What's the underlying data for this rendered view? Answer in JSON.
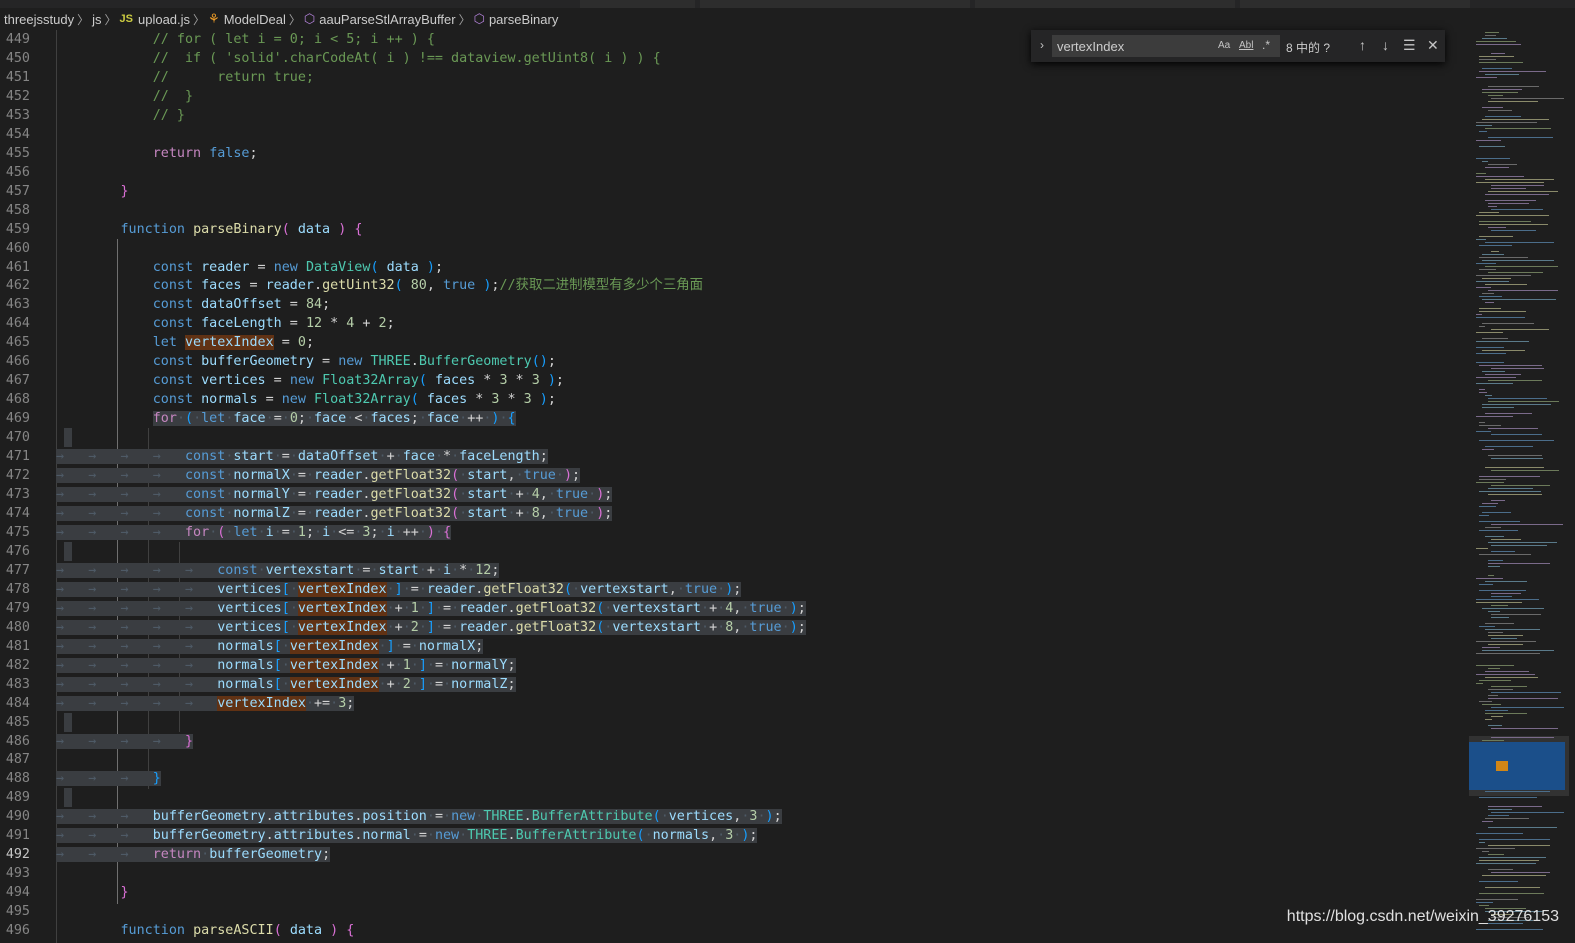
{
  "breadcrumb": {
    "items": [
      "threejsstudy",
      "js",
      "upload.js",
      "ModelDeal",
      "aauParseStlArrayBuffer",
      "parseBinary"
    ],
    "file_badge": "JS"
  },
  "find_widget": {
    "query": "vertexIndex",
    "match_case": "Aa",
    "whole_word": "Abl",
    "regex": ".*",
    "count": "8 中的 ?"
  },
  "editor": {
    "active_line": 492,
    "lines": [
      {
        "n": "449",
        "html": "<span class='cm'>// for ( let i = 0; i &lt; 5; i ++ ) {</span>",
        "pad": 6
      },
      {
        "n": "450",
        "html": "<span class='cm'>//  if ( 'solid'.charCodeAt( i ) !== dataview.getUint8( i ) ) {</span>",
        "pad": 6
      },
      {
        "n": "451",
        "html": "<span class='cm'>//      return true;</span>",
        "pad": 6
      },
      {
        "n": "452",
        "html": "<span class='cm'>//  }</span>",
        "pad": 6
      },
      {
        "n": "453",
        "html": "<span class='cm'>// }</span>",
        "pad": 6
      },
      {
        "n": "454",
        "html": "",
        "pad": 0
      },
      {
        "n": "455",
        "html": "<span class='ctl'>return</span> <span class='kw'>false</span>;",
        "pad": 6
      },
      {
        "n": "456",
        "html": "",
        "pad": 0
      },
      {
        "n": "457",
        "html": "<span class='b2'>}</span>",
        "pad": 4
      },
      {
        "n": "458",
        "html": "",
        "pad": 0
      },
      {
        "n": "459",
        "html": "<span class='kw'>function</span> <span class='fn'>parseBinary</span><span class='b2'>(</span> <span class='var'>data</span> <span class='b2'>)</span> <span class='b2'>{</span>",
        "pad": 4
      },
      {
        "n": "460",
        "html": "",
        "pad": 0
      },
      {
        "n": "461",
        "html": "<span class='kw'>const</span> <span class='var'>reader</span> = <span class='kw'>new</span> <span class='cls'>DataView</span><span class='b3'>(</span> <span class='var'>data</span> <span class='b3'>)</span>;",
        "pad": 6
      },
      {
        "n": "462",
        "html": "<span class='kw'>const</span> <span class='var'>faces</span> = <span class='var'>reader</span>.<span class='fn'>getUint32</span><span class='b3'>(</span> <span class='num'>80</span>, <span class='kw'>true</span> <span class='b3'>)</span>;<span class='cm'>//获取二进制模型有多少个三角面</span>",
        "pad": 6
      },
      {
        "n": "463",
        "html": "<span class='kw'>const</span> <span class='var'>dataOffset</span> = <span class='num'>84</span>;",
        "pad": 6
      },
      {
        "n": "464",
        "html": "<span class='kw'>const</span> <span class='var'>faceLength</span> = <span class='num'>12</span> * <span class='num'>4</span> + <span class='num'>2</span>;",
        "pad": 6
      },
      {
        "n": "465",
        "html": "<span class='kw'>let</span> <span class='var fm'>vertexIndex</span> = <span class='num'>0</span>;",
        "pad": 6
      },
      {
        "n": "466",
        "html": "<span class='kw'>const</span> <span class='var'>bufferGeometry</span> = <span class='kw'>new</span> <span class='cls'>THREE</span>.<span class='cls'>BufferGeometry</span><span class='b3'>()</span>;",
        "pad": 6
      },
      {
        "n": "467",
        "html": "<span class='kw'>const</span> <span class='var'>vertices</span> = <span class='kw'>new</span> <span class='cls'>Float32Array</span><span class='b3'>(</span> <span class='var'>faces</span> * <span class='num'>3</span> * <span class='num'>3</span> <span class='b3'>)</span>;",
        "pad": 6
      },
      {
        "n": "468",
        "html": "<span class='kw'>const</span> <span class='var'>normals</span> = <span class='kw'>new</span> <span class='cls'>Float32Array</span><span class='b3'>(</span> <span class='var'>faces</span> * <span class='num'>3</span> * <span class='num'>3</span> <span class='b3'>)</span>;",
        "pad": 6
      },
      {
        "n": "469",
        "html": "<span class='sel'><span class='ctl'>for</span><span class='ws'>·</span><span class='b3'>(</span><span class='ws'>·</span><span class='kw'>let</span><span class='ws'>·</span><span class='var'>face</span><span class='ws'>·</span>=<span class='ws'>·</span><span class='num'>0</span>;<span class='ws'>·</span><span class='var'>face</span><span class='ws'>·</span>&lt;<span class='ws'>·</span><span class='var'>faces</span>;<span class='ws'>·</span><span class='var'>face</span><span class='ws'>·</span>++<span class='ws'>·</span><span class='b3'>)</span><span class='ws'>·</span><span class='b3'>{</span></span>",
        "pad": 6,
        "selfrom": 6
      },
      {
        "n": "470",
        "html": "",
        "pad": 0,
        "selblank": true
      },
      {
        "n": "471",
        "html": "<span class='kw'>const</span><span class='ws'>·</span><span class='var'>start</span><span class='ws'>·</span>=<span class='ws'>·</span><span class='var'>dataOffset</span><span class='ws'>·</span>+<span class='ws'>·</span><span class='var'>face</span><span class='ws'>·</span>*<span class='ws'>·</span><span class='var'>faceLength</span>;",
        "pad": 8,
        "tabs": 4,
        "selall": true
      },
      {
        "n": "472",
        "html": "<span class='kw'>const</span><span class='ws'>·</span><span class='var'>normalX</span><span class='ws'>·</span>=<span class='ws'>·</span><span class='var'>reader</span>.<span class='fn'>getFloat32</span><span class='b2'>(</span><span class='ws'>·</span><span class='var'>start</span>,<span class='ws'>·</span><span class='kw'>true</span><span class='ws'>·</span><span class='b2'>)</span>;",
        "pad": 8,
        "tabs": 4,
        "selall": true
      },
      {
        "n": "473",
        "html": "<span class='kw'>const</span><span class='ws'>·</span><span class='var'>normalY</span><span class='ws'>·</span>=<span class='ws'>·</span><span class='var'>reader</span>.<span class='fn'>getFloat32</span><span class='b2'>(</span><span class='ws'>·</span><span class='var'>start</span><span class='ws'>·</span>+<span class='ws'>·</span><span class='num'>4</span>,<span class='ws'>·</span><span class='kw'>true</span><span class='ws'>·</span><span class='b2'>)</span>;",
        "pad": 8,
        "tabs": 4,
        "selall": true
      },
      {
        "n": "474",
        "html": "<span class='kw'>const</span><span class='ws'>·</span><span class='var'>normalZ</span><span class='ws'>·</span>=<span class='ws'>·</span><span class='var'>reader</span>.<span class='fn'>getFloat32</span><span class='b2'>(</span><span class='ws'>·</span><span class='var'>start</span><span class='ws'>·</span>+<span class='ws'>·</span><span class='num'>8</span>,<span class='ws'>·</span><span class='kw'>true</span><span class='ws'>·</span><span class='b2'>)</span>;",
        "pad": 8,
        "tabs": 4,
        "selall": true
      },
      {
        "n": "475",
        "html": "<span class='ctl'>for</span><span class='ws'>·</span><span class='b2'>(</span><span class='ws'>·</span><span class='kw'>let</span><span class='ws'>·</span><span class='var'>i</span><span class='ws'>·</span>=<span class='ws'>·</span><span class='num'>1</span>;<span class='ws'>·</span><span class='var'>i</span><span class='ws'>·</span>&lt;=<span class='ws'>·</span><span class='num'>3</span>;<span class='ws'>·</span><span class='var'>i</span><span class='ws'>·</span>++<span class='ws'>·</span><span class='b2'>)</span><span class='ws'>·</span><span class='b2'>{</span>",
        "pad": 8,
        "tabs": 4,
        "selall": true
      },
      {
        "n": "476",
        "html": "",
        "pad": 0,
        "selblank": true
      },
      {
        "n": "477",
        "html": "<span class='kw'>const</span><span class='ws'>·</span><span class='var'>vertexstart</span><span class='ws'>·</span>=<span class='ws'>·</span><span class='var'>start</span><span class='ws'>·</span>+<span class='ws'>·</span><span class='var'>i</span><span class='ws'>·</span>*<span class='ws'>·</span><span class='num'>12</span>;",
        "pad": 10,
        "tabs": 5,
        "selall": true
      },
      {
        "n": "478",
        "html": "<span class='var'>vertices</span><span class='b3'>[</span><span class='ws'>·</span><span class='var fm'>vertexIndex</span><span class='ws'>·</span><span class='b3'>]</span><span class='ws'>·</span>=<span class='ws'>·</span><span class='var'>reader</span>.<span class='fn'>getFloat32</span><span class='b3'>(</span><span class='ws'>·</span><span class='var'>vertexstart</span>,<span class='ws'>·</span><span class='kw'>true</span><span class='ws'>·</span><span class='b3'>)</span>;",
        "pad": 10,
        "tabs": 5,
        "selall": true
      },
      {
        "n": "479",
        "html": "<span class='var'>vertices</span><span class='b3'>[</span><span class='ws'>·</span><span class='var fm'>vertexIndex</span><span class='ws'>·</span>+<span class='ws'>·</span><span class='num'>1</span><span class='ws'>·</span><span class='b3'>]</span><span class='ws'>·</span>=<span class='ws'>·</span><span class='var'>reader</span>.<span class='fn'>getFloat32</span><span class='b3'>(</span><span class='ws'>·</span><span class='var'>vertexstart</span><span class='ws'>·</span>+<span class='ws'>·</span><span class='num'>4</span>,<span class='ws'>·</span><span class='kw'>true</span><span class='ws'>·</span><span class='b3'>)</span>;",
        "pad": 10,
        "tabs": 5,
        "selall": true
      },
      {
        "n": "480",
        "html": "<span class='var'>vertices</span><span class='b3'>[</span><span class='ws'>·</span><span class='var fm'>vertexIndex</span><span class='ws'>·</span>+<span class='ws'>·</span><span class='num'>2</span><span class='ws'>·</span><span class='b3'>]</span><span class='ws'>·</span>=<span class='ws'>·</span><span class='var'>reader</span>.<span class='fn'>getFloat32</span><span class='b3'>(</span><span class='ws'>·</span><span class='var'>vertexstart</span><span class='ws'>·</span>+<span class='ws'>·</span><span class='num'>8</span>,<span class='ws'>·</span><span class='kw'>true</span><span class='ws'>·</span><span class='b3'>)</span>;",
        "pad": 10,
        "tabs": 5,
        "selall": true
      },
      {
        "n": "481",
        "html": "<span class='var'>normals</span><span class='b3'>[</span><span class='ws'>·</span><span class='var fm'>vertexIndex</span><span class='ws'>·</span><span class='b3'>]</span><span class='ws'>·</span>=<span class='ws'>·</span><span class='var'>normalX</span>;",
        "pad": 10,
        "tabs": 5,
        "selall": true
      },
      {
        "n": "482",
        "html": "<span class='var'>normals</span><span class='b3'>[</span><span class='ws'>·</span><span class='var fm'>vertexIndex</span><span class='ws'>·</span>+<span class='ws'>·</span><span class='num'>1</span><span class='ws'>·</span><span class='b3'>]</span><span class='ws'>·</span>=<span class='ws'>·</span><span class='var'>normalY</span>;",
        "pad": 10,
        "tabs": 5,
        "selall": true
      },
      {
        "n": "483",
        "html": "<span class='var'>normals</span><span class='b3'>[</span><span class='ws'>·</span><span class='var fm'>vertexIndex</span><span class='ws'>·</span>+<span class='ws'>·</span><span class='num'>2</span><span class='ws'>·</span><span class='b3'>]</span><span class='ws'>·</span>=<span class='ws'>·</span><span class='var'>normalZ</span>;",
        "pad": 10,
        "tabs": 5,
        "selall": true
      },
      {
        "n": "484",
        "html": "<span class='var fm'>vertexIndex</span><span class='ws'>·</span>+=<span class='ws'>·</span><span class='num'>3</span>;",
        "pad": 10,
        "tabs": 5,
        "selall": true
      },
      {
        "n": "485",
        "html": "",
        "pad": 0,
        "selblank": true
      },
      {
        "n": "486",
        "html": "<span class='b2'>}</span>",
        "pad": 8,
        "tabs": 4,
        "selall": true
      },
      {
        "n": "487",
        "html": "",
        "pad": 0
      },
      {
        "n": "488",
        "html": "<span class='b3'>}</span>",
        "pad": 6,
        "tabs": 3,
        "selall": true
      },
      {
        "n": "489",
        "html": "",
        "pad": 0,
        "selblank": true
      },
      {
        "n": "490",
        "html": "<span class='var'>bufferGeometry</span>.<span class='var'>attributes</span>.<span class='var'>position</span><span class='ws'>·</span>=<span class='ws'>·</span><span class='kw'>new</span><span class='ws'>·</span><span class='cls'>THREE</span>.<span class='cls'>BufferAttribute</span><span class='b3'>(</span><span class='ws'>·</span><span class='var'>vertices</span>,<span class='ws'>·</span><span class='num'>3</span><span class='ws'>·</span><span class='b3'>)</span>;",
        "pad": 6,
        "tabs": 3,
        "selall": true
      },
      {
        "n": "491",
        "html": "<span class='var'>bufferGeometry</span>.<span class='var'>attributes</span>.<span class='var'>normal</span><span class='ws'>·</span>=<span class='ws'>·</span><span class='kw'>new</span><span class='ws'>·</span><span class='cls'>THREE</span>.<span class='cls'>BufferAttribute</span><span class='b3'>(</span><span class='ws'>·</span><span class='var'>normals</span>,<span class='ws'>·</span><span class='num'>3</span><span class='ws'>·</span><span class='b3'>)</span>;",
        "pad": 6,
        "tabs": 3,
        "selall": true
      },
      {
        "n": "492",
        "html": "<span class='ctl'>return</span><span class='ws'>·</span><span class='var'>bufferGeometry</span>;",
        "pad": 6,
        "tabs": 3,
        "selall": true
      },
      {
        "n": "493",
        "html": "",
        "pad": 0
      },
      {
        "n": "494",
        "html": "<span class='b2'>}</span>",
        "pad": 4
      },
      {
        "n": "495",
        "html": "",
        "pad": 0
      },
      {
        "n": "496",
        "html": "<span class='kw'>function</span> <span class='fn'>parseASCII</span><span class='b2'>(</span> <span class='var'>data</span> <span class='b2'>)</span> <span class='b2'>{</span>",
        "pad": 4
      }
    ]
  },
  "watermark": "https://blog.csdn.net/weixin_39276153",
  "colors": {
    "background": "#1e1e1e",
    "selection": "#3a3d41",
    "find_match": "#613214",
    "keyword": "#569cd6",
    "function": "#dcdcaa",
    "variable": "#9cdcfe",
    "comment": "#6a9955"
  }
}
